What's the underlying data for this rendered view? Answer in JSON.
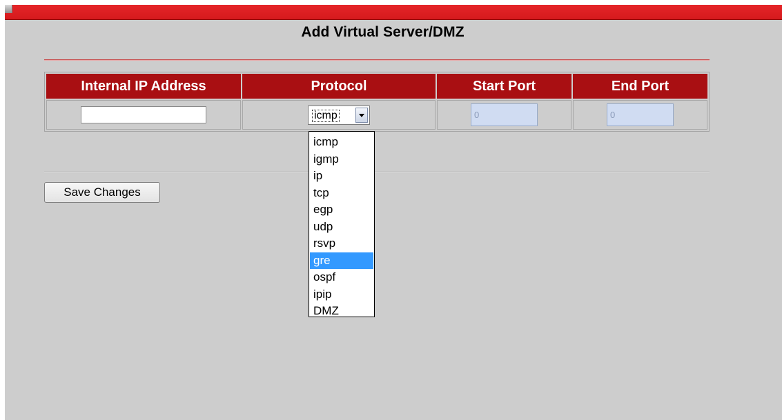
{
  "page": {
    "title": "Add Virtual Server/DMZ"
  },
  "table": {
    "headers": {
      "internal_ip": "Internal IP Address",
      "protocol": "Protocol",
      "start_port": "Start Port",
      "end_port": "End Port"
    },
    "row": {
      "internal_ip_value": "",
      "protocol_value": "icmp",
      "start_port_value": "0",
      "end_port_value": "0"
    }
  },
  "protocol_dropdown": {
    "open": true,
    "options": [
      "icmp",
      "igmp",
      "ip",
      "tcp",
      "egp",
      "udp",
      "rsvp",
      "gre",
      "ospf",
      "ipip",
      "DMZ"
    ],
    "highlighted": "gre"
  },
  "actions": {
    "save_label": "Save Changes"
  },
  "colors": {
    "top_bar": "#d51a1d",
    "header_bg": "#a90f12",
    "page_bg": "#cdcdcd",
    "highlight": "#3399ff"
  },
  "icons": {
    "top_bar_icon": "window-icon",
    "dropdown_arrow": "chevron-down-icon"
  }
}
